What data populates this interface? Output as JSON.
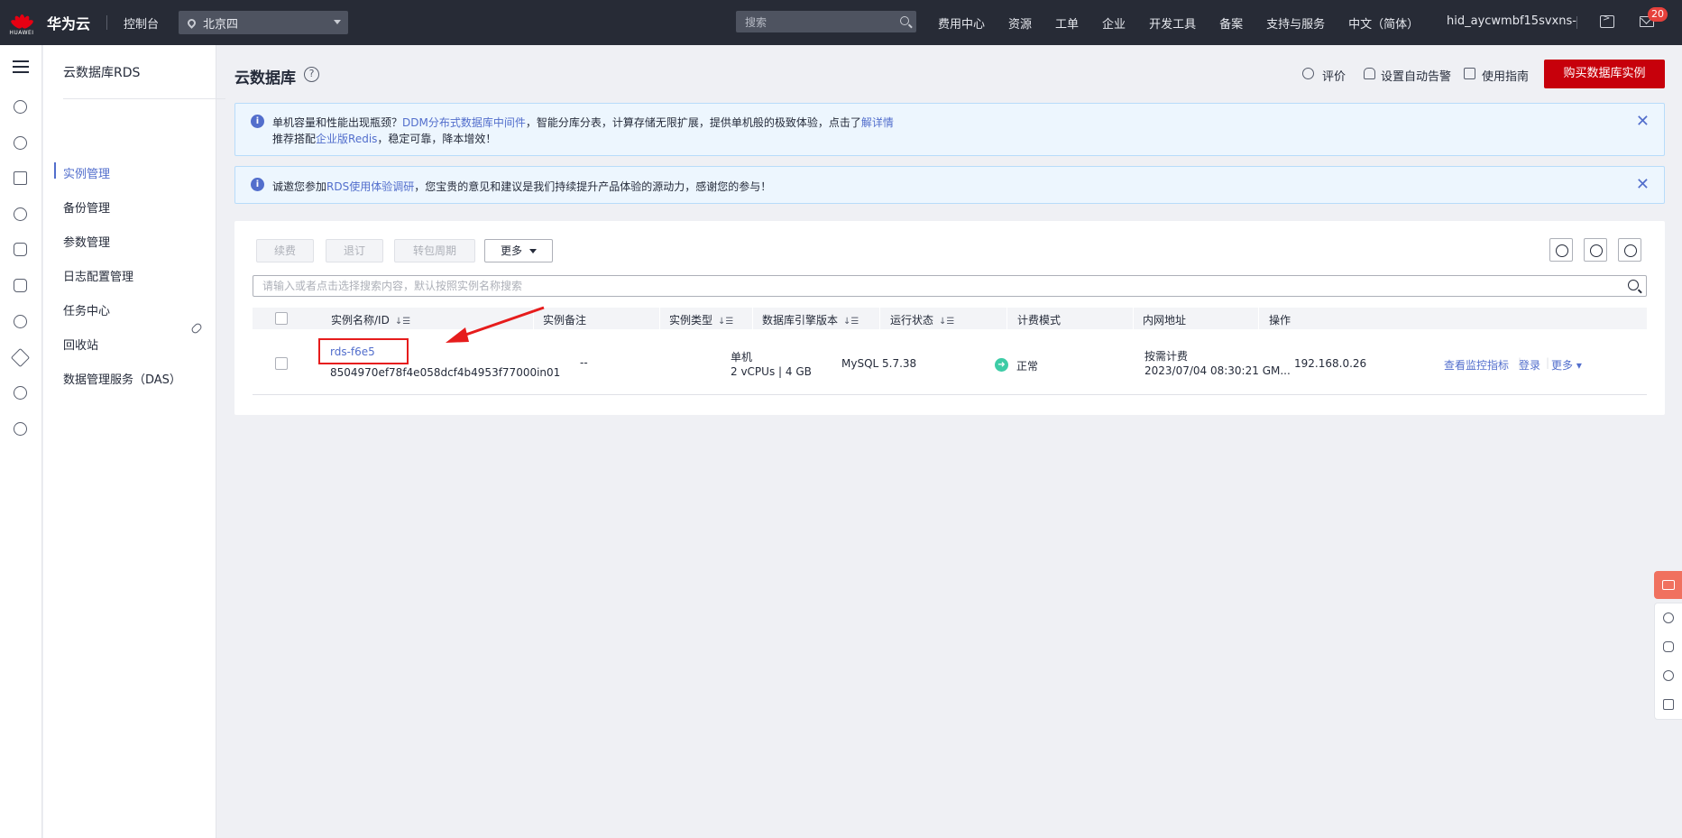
{
  "topbar": {
    "logo_text": "HUAWEI",
    "brand": "华为云",
    "console": "控制台",
    "region": "北京四",
    "search_placeholder": "搜索",
    "nav": [
      "费用中心",
      "资源",
      "工单",
      "企业",
      "开发工具",
      "备案",
      "支持与服务",
      "中文（简体）"
    ],
    "user": "hid_aycwmbf15svxns-",
    "message_count": "20"
  },
  "sidebar": {
    "title": "云数据库RDS",
    "items": [
      {
        "label": "实例管理",
        "active": true
      },
      {
        "label": "备份管理"
      },
      {
        "label": "参数管理"
      },
      {
        "label": "日志配置管理"
      },
      {
        "label": "任务中心"
      },
      {
        "label": "回收站"
      },
      {
        "label": "数据管理服务（DAS）"
      }
    ]
  },
  "header": {
    "title": "云数据库",
    "rate": "评价",
    "alarm": "设置自动告警",
    "guide": "使用指南",
    "buy": "购买数据库实例"
  },
  "alerts": {
    "first_a": "单机容量和性能出现瓶颈？",
    "first_link": "DDM分布式数据库中间件",
    "first_b": "，智能分库分表，计算存储无限扩展，提供单机般的极致体验，点击了",
    "first_link2": "解详情",
    "first_c": "推荐搭配",
    "first_link3": "企业版Redis",
    "first_d": "，稳定可靠，降本增效！",
    "second_a": "诚邀您参加",
    "second_link": "RDS使用体验调研",
    "second_b": "，您宝贵的意见和建议是我们持续提升产品体验的源动力，感谢您的参与！"
  },
  "toolbar": {
    "renew": "续费",
    "unsubscribe": "退订",
    "to_period": "转包周期",
    "more": "更多",
    "search_placeholder": "请输入或者点击选择搜索内容，默认按照实例名称搜索"
  },
  "table": {
    "columns": [
      "实例名称/ID",
      "实例备注",
      "实例类型",
      "数据库引擎版本",
      "运行状态",
      "计费模式",
      "内网地址",
      "操作"
    ],
    "rows": [
      {
        "name": "rds-f6e5",
        "id": "8504970ef78f4e058dcf4b4953f77000in01",
        "remark": "--",
        "type": "单机",
        "spec": "2 vCPUs | 4 GB",
        "engine": "MySQL 5.7.38",
        "status": "正常",
        "billing": "按需计费",
        "created": "2023/07/04 08:30:21 GM...",
        "ip": "192.168.0.26",
        "actions": [
          "查看监控指标",
          "登录",
          "更多"
        ]
      }
    ]
  },
  "colors": {
    "accent": "#526ecc",
    "buy": "#c7000b",
    "status_ok": "#3dcca6",
    "highlight": "#e61c1c"
  }
}
